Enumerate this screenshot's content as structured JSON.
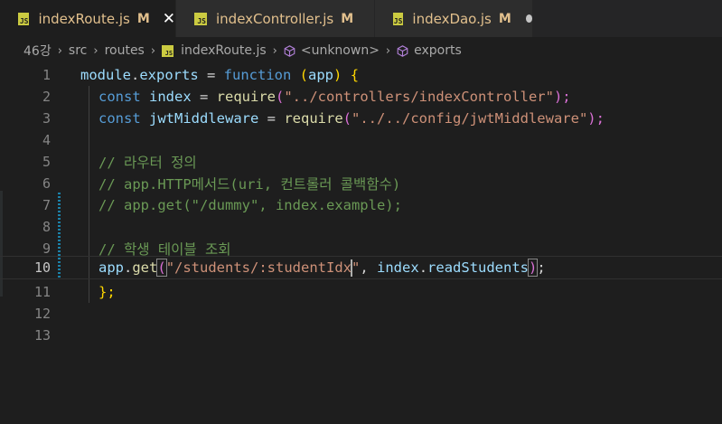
{
  "tabs": [
    {
      "name": "indexRoute.js",
      "badge": "JS",
      "status": "M",
      "active": true
    },
    {
      "name": "indexController.js",
      "badge": "JS",
      "status": "M",
      "active": false
    },
    {
      "name": "indexDao.js",
      "badge": "JS",
      "status": "M",
      "active": false
    }
  ],
  "breadcrumb": {
    "items": [
      "46강",
      "src",
      "routes",
      "indexRoute.js",
      "<unknown>",
      "exports"
    ]
  },
  "editor": {
    "current_line": 10,
    "lines": [
      {
        "num": "1"
      },
      {
        "num": "2"
      },
      {
        "num": "3"
      },
      {
        "num": "4"
      },
      {
        "num": "5"
      },
      {
        "num": "6"
      },
      {
        "num": "7"
      },
      {
        "num": "8"
      },
      {
        "num": "9"
      },
      {
        "num": "10"
      },
      {
        "num": "11"
      },
      {
        "num": "12"
      },
      {
        "num": "13"
      }
    ],
    "code": {
      "l1_module": "module",
      "l1_dot": ".",
      "l1_exports": "exports",
      "l1_eq": " = ",
      "l1_function": "function",
      "l1_sp": " ",
      "l1_paren_open": "(",
      "l1_app": "app",
      "l1_paren_close": ")",
      "l1_brace": " {",
      "l2_const": "const",
      "l2_index": " index",
      "l2_eq": " = ",
      "l2_require": "require",
      "l2_po": "(",
      "l2_str": "\"../controllers/indexController\"",
      "l2_pc": ");",
      "l3_const": "const",
      "l3_var": " jwtMiddleware",
      "l3_eq": " = ",
      "l3_require": "require",
      "l3_po": "(",
      "l3_str": "\"../../config/jwtMiddleware\"",
      "l3_pc": ");",
      "l5": "// 라우터 정의",
      "l6": "// app.HTTP메서드(uri, 컨트롤러 콜백함수)",
      "l7": "// app.get(\"/dummy\", index.example);",
      "l9": "// 학생 테이블 조회",
      "l10_app": "app",
      "l10_dot": ".",
      "l10_get": "get",
      "l10_po": "(",
      "l10_str_a": "\"/students/:studentIdx",
      "l10_str_b": "\"",
      "l10_comma": ", ",
      "l10_index": "index",
      "l10_dot2": ".",
      "l10_read": "readStudents",
      "l10_pc": ")",
      "l10_semi": ";",
      "l11": "};"
    }
  },
  "colors": {
    "background": "#1e1e1e",
    "keyword": "#569cd6",
    "function": "#dcdcaa",
    "variable": "#9cdcfe",
    "string": "#ce9178",
    "comment": "#6a9955",
    "modified": "#e2c08d"
  }
}
